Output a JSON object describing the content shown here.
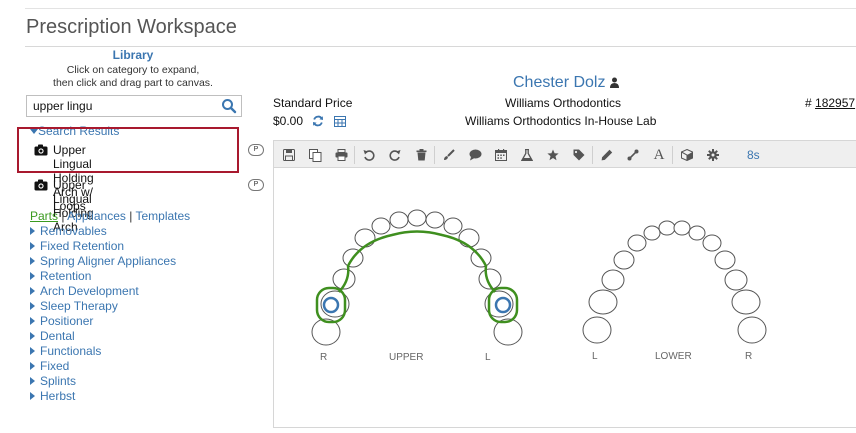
{
  "page": {
    "title": "Prescription Workspace"
  },
  "library": {
    "title": "Library",
    "hint_line1": "Click on category to expand,",
    "hint_line2": "then click and drag part to canvas.",
    "search_value": "upper lingu",
    "search_results_header": "Search Results",
    "results": [
      {
        "line1": "Upper Lingual Holding Arch w/",
        "line2": "Loops",
        "badge": "P"
      },
      {
        "line1": "Upper Lingual Holding Arch",
        "badge": "P"
      }
    ],
    "tabs": {
      "parts": "Parts",
      "appliances": "Appliances",
      "templates": "Templates",
      "separator": "|"
    },
    "categories": [
      "Removables",
      "Fixed Retention",
      "Spring Aligner Appliances",
      "Retention",
      "Arch Development",
      "Sleep Therapy",
      "Positioner",
      "Dental",
      "Functionals",
      "Fixed",
      "Splints",
      "Herbst"
    ]
  },
  "header": {
    "patient_name": "Chester Dolz",
    "price_label": "Standard Price",
    "price_value": "$0.00",
    "practice": "Williams Orthodontics",
    "lab": "Williams Orthodontics In-House Lab",
    "rx_prefix": "#",
    "rx_number": "182957"
  },
  "toolbar": {
    "timer": "8s",
    "icons": [
      "save-icon",
      "copy-icon",
      "print-icon",
      "undo-icon",
      "redo-icon",
      "trash-icon",
      "brush-icon",
      "comment-icon",
      "calendar-icon",
      "flask-icon",
      "star-icon",
      "tag-icon",
      "pencil-icon",
      "connector-icon",
      "text-icon",
      "cube-icon",
      "gear-icon"
    ]
  },
  "canvas": {
    "upper": {
      "right": "R",
      "label": "UPPER",
      "left": "L"
    },
    "lower": {
      "left": "L",
      "label": "LOWER",
      "right": "R"
    }
  },
  "colors": {
    "link": "#3b76b0",
    "active_tab": "#3a9a1f",
    "highlight_border": "#a8192e",
    "appliance_wire": "#3f8f1f",
    "band_ring": "#3b76b0"
  }
}
